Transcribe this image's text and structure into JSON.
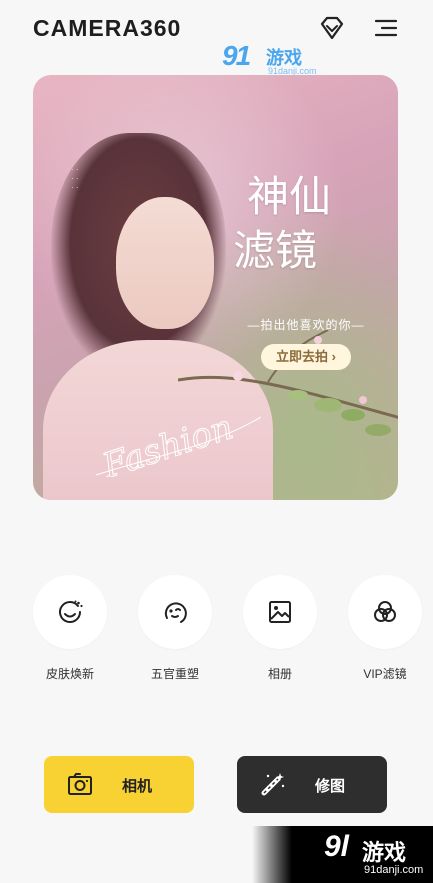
{
  "header": {
    "logo": "CAMERA360",
    "vip_icon": "diamond-icon",
    "menu_icon": "menu-icon"
  },
  "watermark": {
    "top_mark": "91",
    "top_text": "游戏",
    "top_url": "91danji.com",
    "bottom_mark": "9l",
    "bottom_text": "游戏",
    "bottom_url": "91danji.com"
  },
  "banner": {
    "title_line1": "神仙",
    "title_line2": "滤镜",
    "subtitle": "—拍出他喜欢的你—",
    "cta": "立即去拍 ›",
    "script_text": "Fashion"
  },
  "features": [
    {
      "label": "皮肤焕新",
      "icon": "face-retouch-icon"
    },
    {
      "label": "五官重塑",
      "icon": "face-reshape-icon"
    },
    {
      "label": "相册",
      "icon": "album-icon"
    },
    {
      "label": "VIP滤镜",
      "icon": "filter-icon"
    }
  ],
  "actions": {
    "camera_label": "相机",
    "edit_label": "修图"
  },
  "colors": {
    "camera_button": "#f8d233",
    "edit_button": "#2e2e2e",
    "background": "#f7f7f7"
  }
}
